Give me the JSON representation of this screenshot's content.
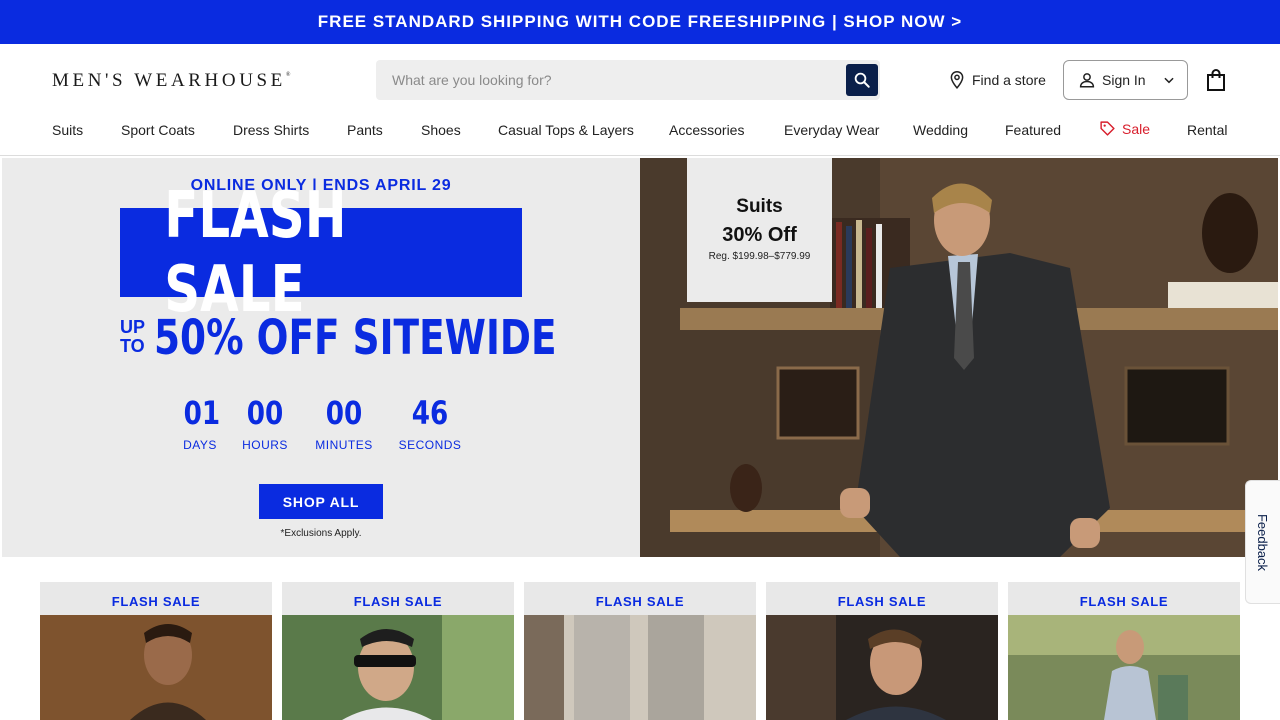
{
  "promo": {
    "text": "FREE STANDARD SHIPPING WITH CODE FREESHIPPING | SHOP NOW >"
  },
  "header": {
    "logo": "MEN'S WEARHOUSE",
    "logo_mark": "®",
    "search": {
      "placeholder": "What are you looking for?",
      "icon": "search-icon"
    },
    "find_store": "Find a store",
    "sign_in": "Sign In",
    "cart_icon": "shopping-bag-icon"
  },
  "nav": {
    "items": [
      "Suits",
      "Sport Coats",
      "Dress Shirts",
      "Pants",
      "Shoes",
      "Casual Tops & Layers",
      "Accessories",
      "Everyday Wear",
      "Wedding",
      "Featured",
      "Sale",
      "Rental"
    ]
  },
  "hero": {
    "subtitle": "ONLINE ONLY | ENDS APRIL 29",
    "headline": "FLASH SALE",
    "up": "UP",
    "to": "TO",
    "offer": "50% OFF SITEWIDE",
    "offer_mark": "*",
    "countdown": {
      "days": "01",
      "days_label": "DAYS",
      "hours": "00",
      "hours_label": "HOURS",
      "minutes": "00",
      "minutes_label": "MINUTES",
      "seconds": "46",
      "seconds_label": "SECONDS"
    },
    "cta": "SHOP ALL",
    "exclusions": "*Exclusions Apply."
  },
  "hero_image": {
    "badge_title": "Suits",
    "badge_offer": "30% Off",
    "badge_reg": "Reg. $199.98–$779.99"
  },
  "feedback": "Feedback",
  "tiles": [
    {
      "label": "FLASH SALE"
    },
    {
      "label": "FLASH SALE"
    },
    {
      "label": "FLASH SALE"
    },
    {
      "label": "FLASH SALE"
    },
    {
      "label": "FLASH SALE"
    }
  ],
  "colors": {
    "brand_blue": "#0a2be0",
    "navy": "#0a1f4a",
    "sale_red": "#d81e2c"
  }
}
